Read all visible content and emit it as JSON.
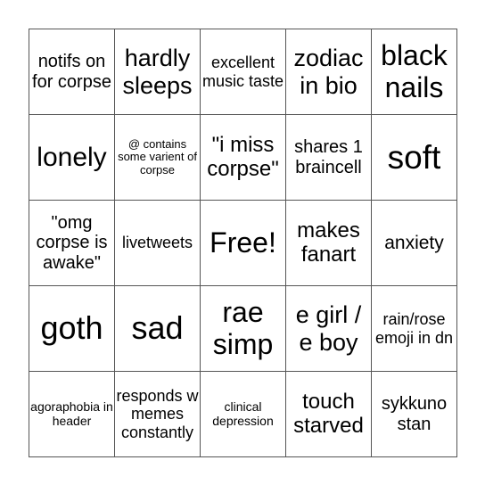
{
  "board": {
    "rows": [
      [
        "notifs on for corpse",
        "hardly sleeps",
        "excellent music taste",
        "zodiac in bio",
        "black nails"
      ],
      [
        "lonely",
        "@ contains some varient of corpse",
        "\"i miss corpse\"",
        "shares 1 braincell",
        "soft"
      ],
      [
        "\"omg corpse is awake\"",
        "livetweets",
        "Free!",
        "makes fanart",
        "anxiety"
      ],
      [
        "goth",
        "sad",
        "rae simp",
        "e girl / e boy",
        "rain/rose emoji in dn"
      ],
      [
        "agoraphobia in header",
        "responds w memes constantly",
        "clinical depression",
        "touch starved",
        "sykkuno stan"
      ]
    ]
  }
}
